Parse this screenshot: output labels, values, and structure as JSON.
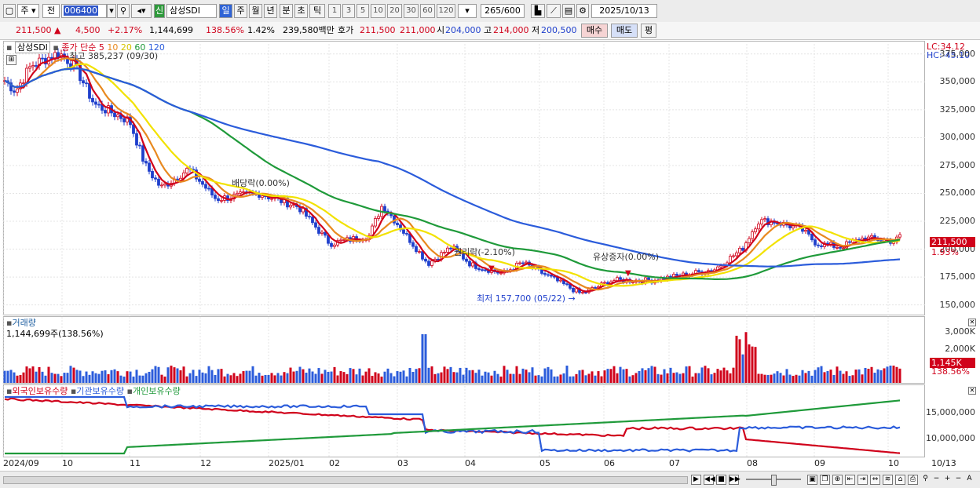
{
  "toolbar": {
    "period_week": "주",
    "prev": "전",
    "code": "006400",
    "stock_name": "삼성SDI",
    "credit_badge": "신",
    "day": "일",
    "week": "주",
    "month": "월",
    "year": "년",
    "minute": "분",
    "second": "초",
    "tick": "틱",
    "intervals": [
      "1",
      "3",
      "5",
      "10",
      "20",
      "30",
      "60",
      "120"
    ],
    "count": "265",
    "count_max": "/600",
    "date": "2025/10/13"
  },
  "quote": {
    "price": "211,500",
    "arrow": "▲",
    "change": "4,500",
    "change_pct": "+2.17%",
    "volume": "1,144,699",
    "volume_ratio": "138.56%",
    "turnover": "1.42%",
    "amount": "239,580백만",
    "ask_label": "호가",
    "ask": "211,500",
    "bid": "211,000",
    "open_label": "시",
    "open": "204,000",
    "high_label": "고",
    "high": "214,000",
    "low_label": "저",
    "low": "200,500",
    "buy": "매수",
    "sell": "매도",
    "eval": "평"
  },
  "price_panel": {
    "name": "삼성SDI",
    "ma_label": "종가 단순",
    "ma_periods": [
      "5",
      "10",
      "20",
      "60",
      "120"
    ],
    "ma_colors": [
      "#d0021b",
      "#e8891f",
      "#f2e200",
      "#1f9a3a",
      "#2b5cdb"
    ],
    "high_note": "최고 385,237 (09/30)",
    "low_note": "최저 157,700 (05/22)",
    "div_note": "배당락(0.00%)",
    "rights_note": "권리락(-2.10%)",
    "issue_note": "유상증자(0.00%)",
    "lc": "LC:34.12",
    "hc": "HC:-45.10",
    "last_tag": "211,500",
    "pct_tag": "1.93%",
    "y_ticks": [
      "375,000",
      "350,000",
      "325,000",
      "300,000",
      "275,000",
      "250,000",
      "225,000",
      "200,000",
      "175,000",
      "150,000"
    ],
    "y_range": [
      142000,
      384000
    ]
  },
  "volume_panel": {
    "title": "거래량",
    "value": "1,144,699주(138.56%)",
    "y_ticks": [
      "3,000K",
      "2,000K",
      "1,000K"
    ],
    "last_tag": "1,145K",
    "pct_tag": "138.56%"
  },
  "holdings_panel": {
    "labels": [
      "외국인보유수량",
      "기관보유수량",
      "개인보유수량"
    ],
    "colors": [
      "#d0021b",
      "#2b5cdb",
      "#1f9a3a"
    ],
    "y_ticks": [
      "15,000,000",
      "10,000,000"
    ]
  },
  "x_ticks": [
    "2024/09",
    "10",
    "11",
    "12",
    "2025/01",
    "02",
    "03",
    "04",
    "05",
    "06",
    "07",
    "08",
    "09",
    "10",
    "10/13"
  ]
}
